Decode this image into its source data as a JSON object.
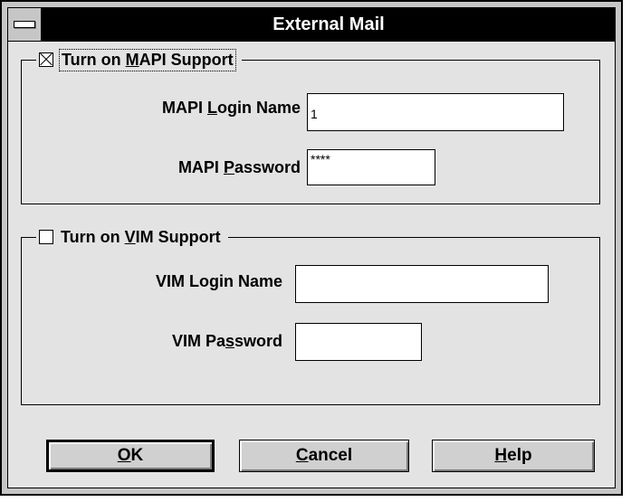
{
  "window": {
    "title": "External Mail"
  },
  "mapi": {
    "enable_pre": "Turn on ",
    "enable_key": "M",
    "enable_post": "API Support",
    "enabled": true,
    "login_pre": "MAPI ",
    "login_key": "L",
    "login_post": "ogin Name",
    "login_value": "1",
    "password_pre": "MAPI ",
    "password_key": "P",
    "password_post": "assword",
    "password_value": "****"
  },
  "vim": {
    "enable_pre": "Turn on ",
    "enable_key": "V",
    "enable_post": "IM Support",
    "enabled": false,
    "login_label": "VIM Login Name",
    "login_value": "",
    "password_pre": "VIM Pa",
    "password_key": "s",
    "password_post": "sword",
    "password_value": ""
  },
  "buttons": {
    "ok_key": "O",
    "ok_rest": "K",
    "cancel_key": "C",
    "cancel_rest": "ancel",
    "help_key": "H",
    "help_rest": "elp"
  }
}
